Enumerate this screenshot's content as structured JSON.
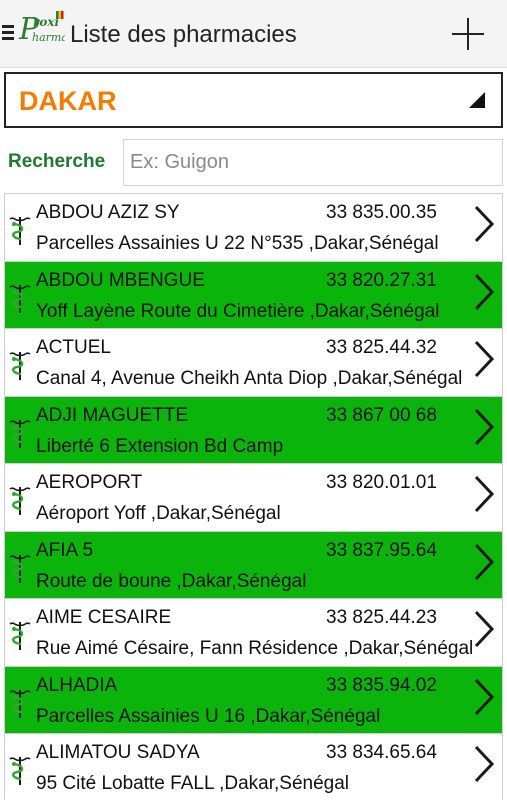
{
  "header": {
    "menu_icon": "hamburger-icon",
    "logo_text": "ProxiPharma",
    "title": "Liste des pharmacies",
    "add_icon": "plus-icon"
  },
  "region": {
    "selected": "DAKAR"
  },
  "search": {
    "label": "Recherche",
    "placeholder": "Ex: Guigon",
    "value": ""
  },
  "colors": {
    "accent_orange": "#f57c00",
    "highlight_green": "#0bb40b",
    "label_green": "#1e7a2e"
  },
  "pharmacies": [
    {
      "name": "ABDOU AZIZ SY",
      "phone": "33 835.00.35",
      "address": "Parcelles Assainies U 22 N°535 ,Dakar,Sénégal",
      "highlight": false
    },
    {
      "name": "ABDOU MBENGUE",
      "phone": "33 820.27.31",
      "address": "Yoff Layène Route du Cimetière ,Dakar,Sénégal",
      "highlight": true
    },
    {
      "name": "ACTUEL",
      "phone": "33 825.44.32",
      "address": "Canal 4, Avenue Cheikh Anta Diop ,Dakar,Sénégal",
      "highlight": false
    },
    {
      "name": "ADJI MAGUETTE",
      "phone": "33 867 00 68",
      "address": "Liberté 6 Extension Bd Camp",
      "highlight": true
    },
    {
      "name": "AEROPORT",
      "phone": "33 820.01.01",
      "address": "Aéroport Yoff ,Dakar,Sénégal",
      "highlight": false
    },
    {
      "name": "AFIA 5",
      "phone": "33 837.95.64",
      "address": "Route de boune ,Dakar,Sénégal",
      "highlight": true
    },
    {
      "name": "AIME CESAIRE",
      "phone": "33 825.44.23",
      "address": "Rue Aimé Césaire, Fann Résidence ,Dakar,Sénégal",
      "highlight": false
    },
    {
      "name": "ALHADIA",
      "phone": "33 835.94.02",
      "address": "Parcelles Assainies U 16 ,Dakar,Sénégal",
      "highlight": true
    },
    {
      "name": "ALIMATOU SADYA",
      "phone": "33 834.65.64",
      "address": "95 Cité Lobatte FALL ,Dakar,Sénégal",
      "highlight": false
    }
  ]
}
